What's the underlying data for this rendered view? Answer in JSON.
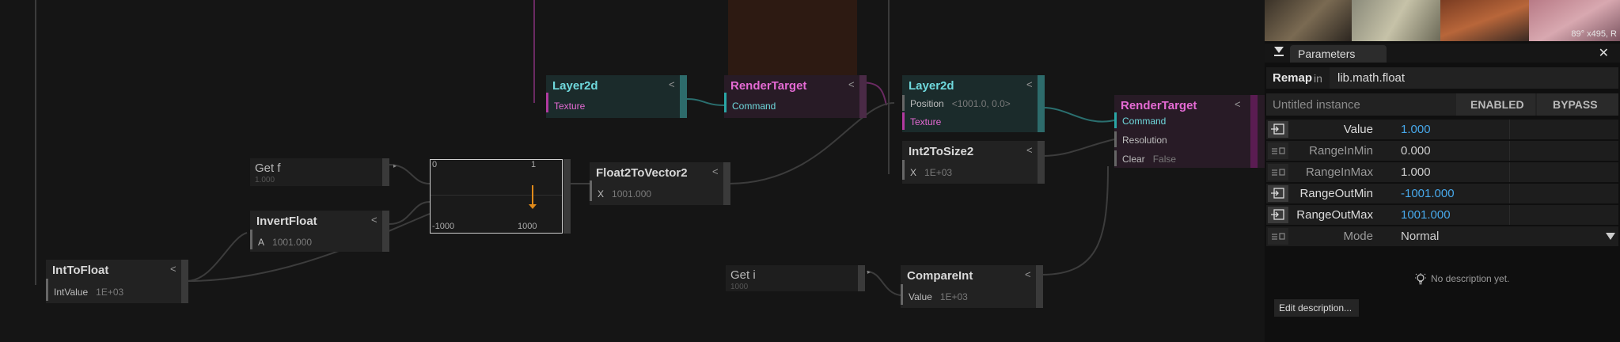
{
  "nodes": {
    "layer2d_a": {
      "title": "Layer2d",
      "input": "Texture"
    },
    "rendertarget_a": {
      "title": "RenderTarget",
      "input": "Command"
    },
    "layer2d_b": {
      "title": "Layer2d",
      "position_label": "Position",
      "position_value": "<1001.0, 0.0>",
      "texture_label": "Texture"
    },
    "rendertarget_b": {
      "title": "RenderTarget",
      "command": "Command",
      "resolution": "Resolution",
      "clear_label": "Clear",
      "clear_value": "False"
    },
    "int2tosize2": {
      "title": "Int2ToSize2",
      "x_label": "X",
      "x_value": "1E+03"
    },
    "get_f": {
      "title": "Get f",
      "value": "1.000"
    },
    "invertfloat": {
      "title": "InvertFloat",
      "a_label": "A",
      "a_value": "1001.000"
    },
    "inttofloat": {
      "title": "IntToFloat",
      "label": "IntValue",
      "value": "1E+03"
    },
    "float2tovector2": {
      "title": "Float2ToVector2",
      "x_label": "X",
      "x_value": "1001.000"
    },
    "get_i": {
      "title": "Get i",
      "value": "1000"
    },
    "compareint": {
      "title": "CompareInt",
      "label": "Value",
      "value": "1E+03"
    },
    "remap_graph": {
      "tl": "0",
      "tr": "1",
      "bl": "-1000",
      "br": "1000"
    }
  },
  "chevron": "<",
  "thumb_caption": "89° x495, R",
  "parameters": {
    "tab": "Parameters",
    "close": "✕",
    "op_name": "Remap",
    "in_label": "in",
    "namespace": "lib.math.float",
    "instance": "Untitled instance",
    "enabled": "ENABLED",
    "bypass": "BYPASS",
    "rows": [
      {
        "name": "Value",
        "value": "1.000"
      },
      {
        "name": "RangeInMin",
        "value": "0.000"
      },
      {
        "name": "RangeInMax",
        "value": "1.000"
      },
      {
        "name": "RangeOutMin",
        "value": "-1001.000"
      },
      {
        "name": "RangeOutMax",
        "value": "1001.000"
      },
      {
        "name": "Mode",
        "value": "Normal"
      }
    ],
    "description": "No description yet.",
    "edit_description": "Edit description..."
  },
  "colors": {
    "bg": "#151515",
    "cyan": "#6fd9dd",
    "pink": "#e46ad3",
    "blue": "#47a8ea",
    "teal": "#2a6f6f",
    "magenta": "#6a2a62"
  }
}
